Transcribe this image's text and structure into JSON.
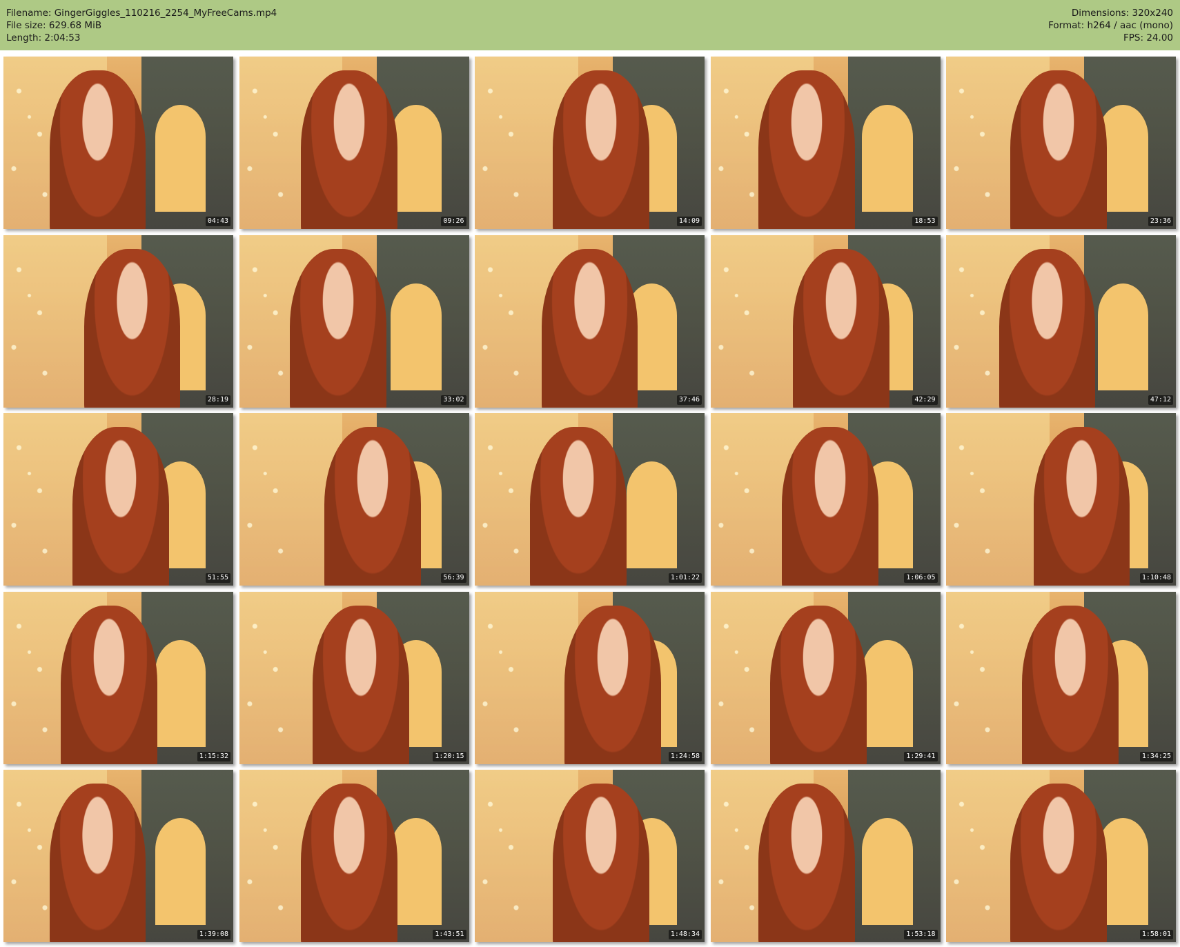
{
  "header": {
    "filename": "Filename: GingerGiggles_110216_2254_MyFreeCams.mp4",
    "filesize": "File size: 629.68 MiB",
    "length": "Length: 2:04:53",
    "dimensions": "Dimensions: 320x240",
    "format": "Format: h264 / aac (mono)",
    "fps": "FPS: 24.00",
    "background_color": "#aec985"
  },
  "thumbnails": [
    {
      "timestamp": "04:43"
    },
    {
      "timestamp": "09:26"
    },
    {
      "timestamp": "14:09"
    },
    {
      "timestamp": "18:53"
    },
    {
      "timestamp": "23:36"
    },
    {
      "timestamp": "28:19"
    },
    {
      "timestamp": "33:02"
    },
    {
      "timestamp": "37:46"
    },
    {
      "timestamp": "42:29"
    },
    {
      "timestamp": "47:12"
    },
    {
      "timestamp": "51:55"
    },
    {
      "timestamp": "56:39"
    },
    {
      "timestamp": "1:01:22"
    },
    {
      "timestamp": "1:06:05"
    },
    {
      "timestamp": "1:10:48"
    },
    {
      "timestamp": "1:15:32"
    },
    {
      "timestamp": "1:20:15"
    },
    {
      "timestamp": "1:24:58"
    },
    {
      "timestamp": "1:29:41"
    },
    {
      "timestamp": "1:34:25"
    },
    {
      "timestamp": "1:39:08"
    },
    {
      "timestamp": "1:43:51"
    },
    {
      "timestamp": "1:48:34"
    },
    {
      "timestamp": "1:53:18"
    },
    {
      "timestamp": "1:58:01"
    }
  ]
}
